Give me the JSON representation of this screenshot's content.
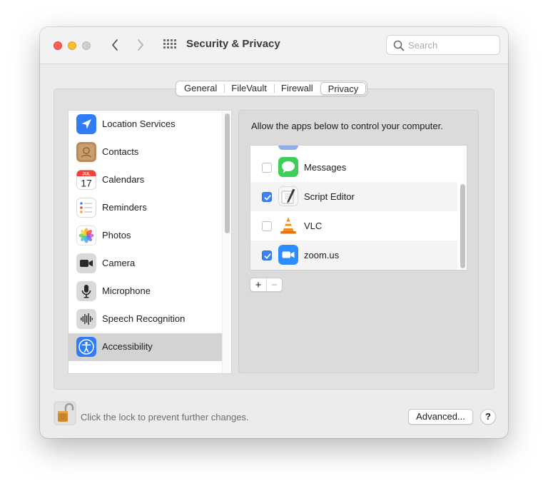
{
  "window": {
    "title": "Security & Privacy",
    "search_placeholder": "Search"
  },
  "tabs": [
    {
      "label": "General",
      "active": false
    },
    {
      "label": "FileVault",
      "active": false
    },
    {
      "label": "Firewall",
      "active": false
    },
    {
      "label": "Privacy",
      "active": true
    }
  ],
  "sidebar": {
    "items": [
      {
        "label": "Location Services",
        "icon": "location-arrow-icon"
      },
      {
        "label": "Contacts",
        "icon": "contacts-icon"
      },
      {
        "label": "Calendars",
        "icon": "calendar-icon",
        "month": "JUL",
        "day": "17"
      },
      {
        "label": "Reminders",
        "icon": "reminders-icon"
      },
      {
        "label": "Photos",
        "icon": "photos-icon"
      },
      {
        "label": "Camera",
        "icon": "camera-icon"
      },
      {
        "label": "Microphone",
        "icon": "microphone-icon"
      },
      {
        "label": "Speech Recognition",
        "icon": "waveform-icon"
      },
      {
        "label": "Accessibility",
        "icon": "accessibility-icon",
        "selected": true
      }
    ]
  },
  "panel": {
    "description": "Allow the apps below to control your computer.",
    "apps": [
      {
        "label": "Messages",
        "checked": false,
        "icon": "messages-icon"
      },
      {
        "label": "Script Editor",
        "checked": true,
        "icon": "script-editor-icon"
      },
      {
        "label": "VLC",
        "checked": false,
        "icon": "vlc-cone-icon"
      },
      {
        "label": "zoom.us",
        "checked": true,
        "icon": "zoom-camera-icon"
      }
    ],
    "add_label": "+",
    "remove_label": "−"
  },
  "footer": {
    "lock_text": "Click the lock to prevent further changes.",
    "advanced_label": "Advanced...",
    "help_label": "?"
  },
  "colors": {
    "accent": "#3b82f6",
    "selection": "#d4d3d3",
    "window_bg": "#ececec"
  }
}
